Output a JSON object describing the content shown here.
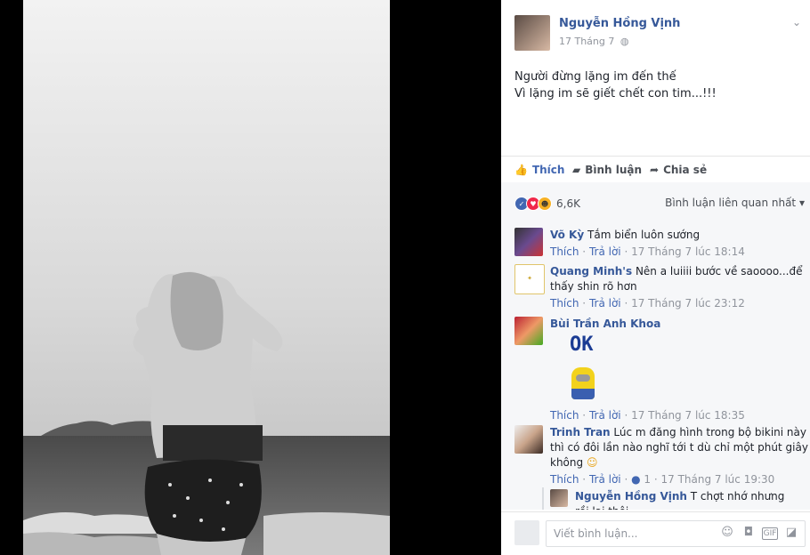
{
  "post": {
    "author": "Nguyễn Hồng Vịnh",
    "date": "17 Tháng 7",
    "privacy_icon": "globe-icon",
    "text_line1": "Người đừng lặng im đến thế",
    "text_line2": "Vì lặng im sẽ giết chết con tim...!!!"
  },
  "actions": {
    "like": "Thích",
    "comment": "Bình luận",
    "share": "Chia sẻ"
  },
  "reactions": {
    "count": "6,6K",
    "sort_label": "Bình luận liên quan nhất"
  },
  "comments": [
    {
      "author": "Võ Kỳ",
      "text": "Tắm biển luôn sướng",
      "like": "Thích",
      "reply": "Trả lời",
      "time": "17 Tháng 7 lúc 18:14"
    },
    {
      "author": "Quang Minh's",
      "text": "Nên a luiiii bước về saoooo...để thấy shin rõ hơn",
      "like": "Thích",
      "reply": "Trả lời",
      "time": "17 Tháng 7 lúc 23:12"
    },
    {
      "author": "Bùi Trần Anh Khoa",
      "sticker_text": "OK",
      "like": "Thích",
      "reply": "Trả lời",
      "time": "17 Tháng 7 lúc 18:35"
    },
    {
      "author": "Trinh Tran",
      "text": "Lúc m đăng hình trong bộ bikini này thì có đôi lần nào nghĩ tới t dù chỉ một phút giây không",
      "like": "Thích",
      "reply": "Trả lời",
      "like_count": "1",
      "time": "17 Tháng 7 lúc 19:30"
    }
  ],
  "reply": {
    "author": "Nguyễn Hồng Vịnh",
    "text": "T chợt nhớ nhưng rồi lại thôi"
  },
  "composer": {
    "placeholder": "Viết bình luận..."
  },
  "colors": {
    "link": "#365899",
    "like_blue": "#4267b2",
    "love_red": "#f0284a"
  }
}
